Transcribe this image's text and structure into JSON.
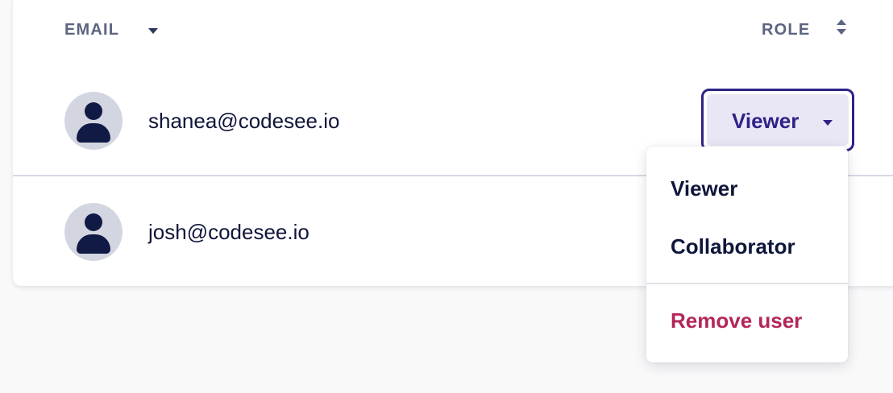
{
  "table": {
    "headers": {
      "email_label": "EMAIL",
      "email_sort_icon": "caret-down-icon",
      "role_label": "ROLE",
      "role_sort_icon": "sort-icon"
    },
    "rows": [
      {
        "email": "shanea@codesee.io",
        "avatar_icon": "user-icon"
      },
      {
        "email": "josh@codesee.io",
        "avatar_icon": "user-icon"
      }
    ]
  },
  "role_select": {
    "value": "Viewer",
    "icon": "caret-down-icon",
    "open": true
  },
  "role_menu": {
    "options": [
      "Viewer",
      "Collaborator"
    ],
    "remove_label": "Remove user"
  },
  "colors": {
    "accent": "#2e2386",
    "accent_bg": "#e9e7f6",
    "text_primary": "#10163a",
    "text_muted": "#5b6480",
    "danger": "#b3265a",
    "avatar_bg": "#d3d6e0"
  }
}
